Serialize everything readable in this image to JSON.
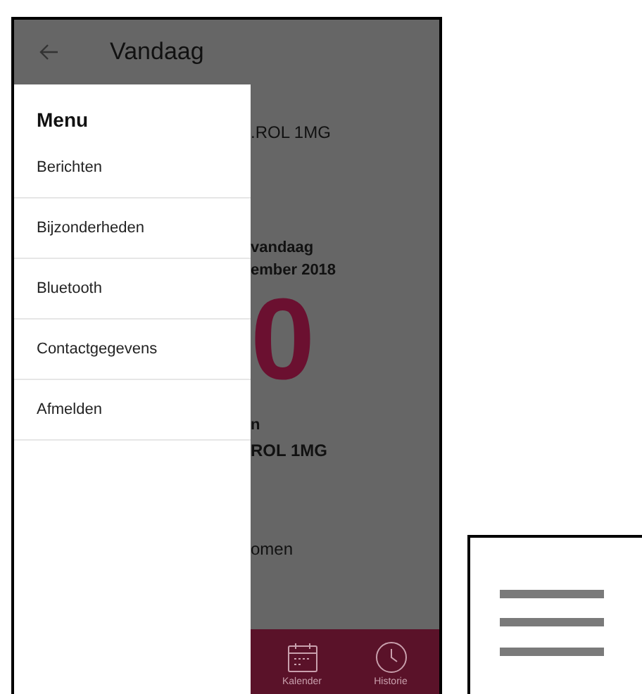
{
  "top_bar": {
    "title": "Vandaag"
  },
  "drawer": {
    "title": "Menu",
    "items": [
      {
        "label": "Berichten"
      },
      {
        "label": "Bijzonderheden"
      },
      {
        "label": "Bluetooth"
      },
      {
        "label": "Contactgegevens"
      },
      {
        "label": "Afmelden"
      }
    ]
  },
  "content": [
    {
      "kind": "name",
      "text": ".ROL 1MG"
    },
    {
      "kind": "heading",
      "text": "vandaag"
    },
    {
      "kind": "heading",
      "text": "ember 2018"
    },
    {
      "kind": "count",
      "text": "0"
    },
    {
      "kind": "heading",
      "text": "n"
    },
    {
      "kind": "name_bold",
      "text": "ROL 1MG"
    },
    {
      "kind": "name",
      "text": "omen"
    }
  ],
  "bottom_nav": [
    {
      "kind": "calendar",
      "label": "Kalender"
    },
    {
      "kind": "history",
      "label": "Historie"
    }
  ]
}
